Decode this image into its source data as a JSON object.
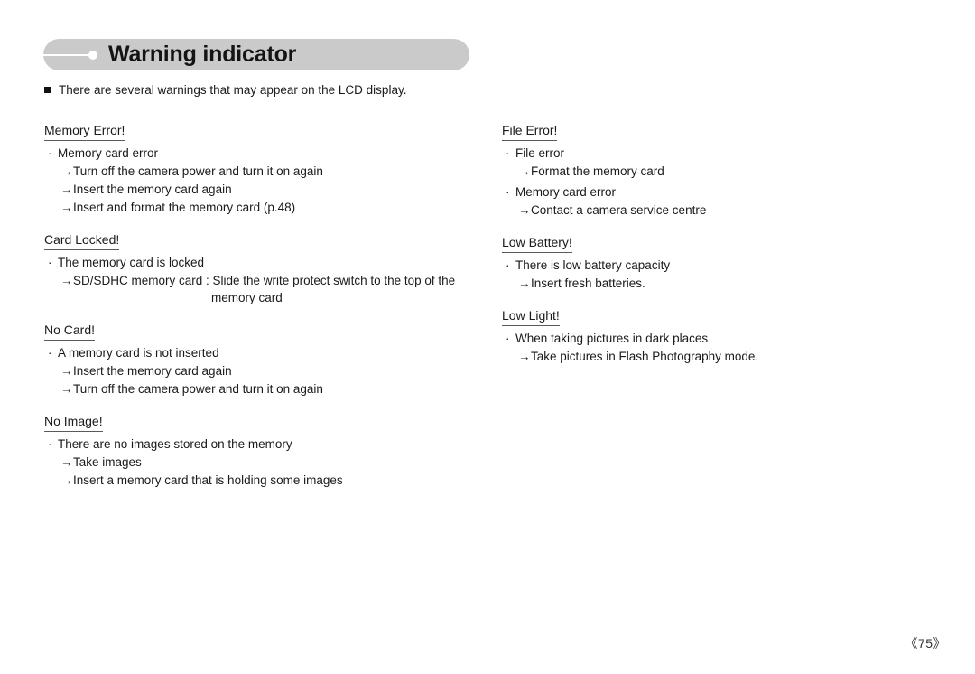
{
  "header": {
    "title": "Warning indicator",
    "marker_icon": "line-dot-marker-icon"
  },
  "intro": {
    "bullet_icon": "square-bullet-icon",
    "text": "There are several warnings that may appear on the LCD display."
  },
  "columns": {
    "left": [
      {
        "heading": "Memory Error!",
        "items": [
          {
            "cause": "Memory card error",
            "actions": [
              {
                "text": "Turn off the camera power and turn it on again"
              },
              {
                "text": "Insert the memory card again"
              },
              {
                "text": "Insert and format the memory card (p.48)"
              }
            ]
          }
        ]
      },
      {
        "heading": "Card Locked!",
        "items": [
          {
            "cause": "The memory card is locked",
            "actions": [
              {
                "text": "SD/SDHC memory card : Slide the write protect switch to the top of the",
                "continuation": "memory card"
              }
            ]
          }
        ]
      },
      {
        "heading": "No Card!",
        "items": [
          {
            "cause": "A memory card is not inserted",
            "actions": [
              {
                "text": "Insert the memory card again"
              },
              {
                "text": "Turn off the camera power and turn it on again"
              }
            ]
          }
        ]
      },
      {
        "heading": "No Image!",
        "items": [
          {
            "cause": "There are no images stored on the memory",
            "actions": [
              {
                "text": "Take images"
              },
              {
                "text": "Insert a memory card that is holding some images"
              }
            ]
          }
        ]
      }
    ],
    "right": [
      {
        "heading": "File Error!",
        "items": [
          {
            "cause": "File error",
            "actions": [
              {
                "text": "Format the memory card"
              }
            ]
          },
          {
            "cause": "Memory card error",
            "actions": [
              {
                "text": "Contact a camera service centre"
              }
            ]
          }
        ]
      },
      {
        "heading": "Low Battery!",
        "items": [
          {
            "cause": "There is low battery capacity",
            "actions": [
              {
                "text": "Insert fresh batteries."
              }
            ]
          }
        ]
      },
      {
        "heading": "Low Light!",
        "extra_gap": true,
        "items": [
          {
            "cause": "When taking pictures in dark places",
            "actions": [
              {
                "text": "Take pictures in Flash Photography mode."
              }
            ]
          }
        ]
      }
    ]
  },
  "footer": {
    "page_number": "《75》"
  },
  "glyphs": {
    "arrow": "→",
    "middot": "·"
  },
  "colors": {
    "banner_bg": "#cacaca",
    "text": "#1a1a1a",
    "rule": "#5a5a5a"
  }
}
